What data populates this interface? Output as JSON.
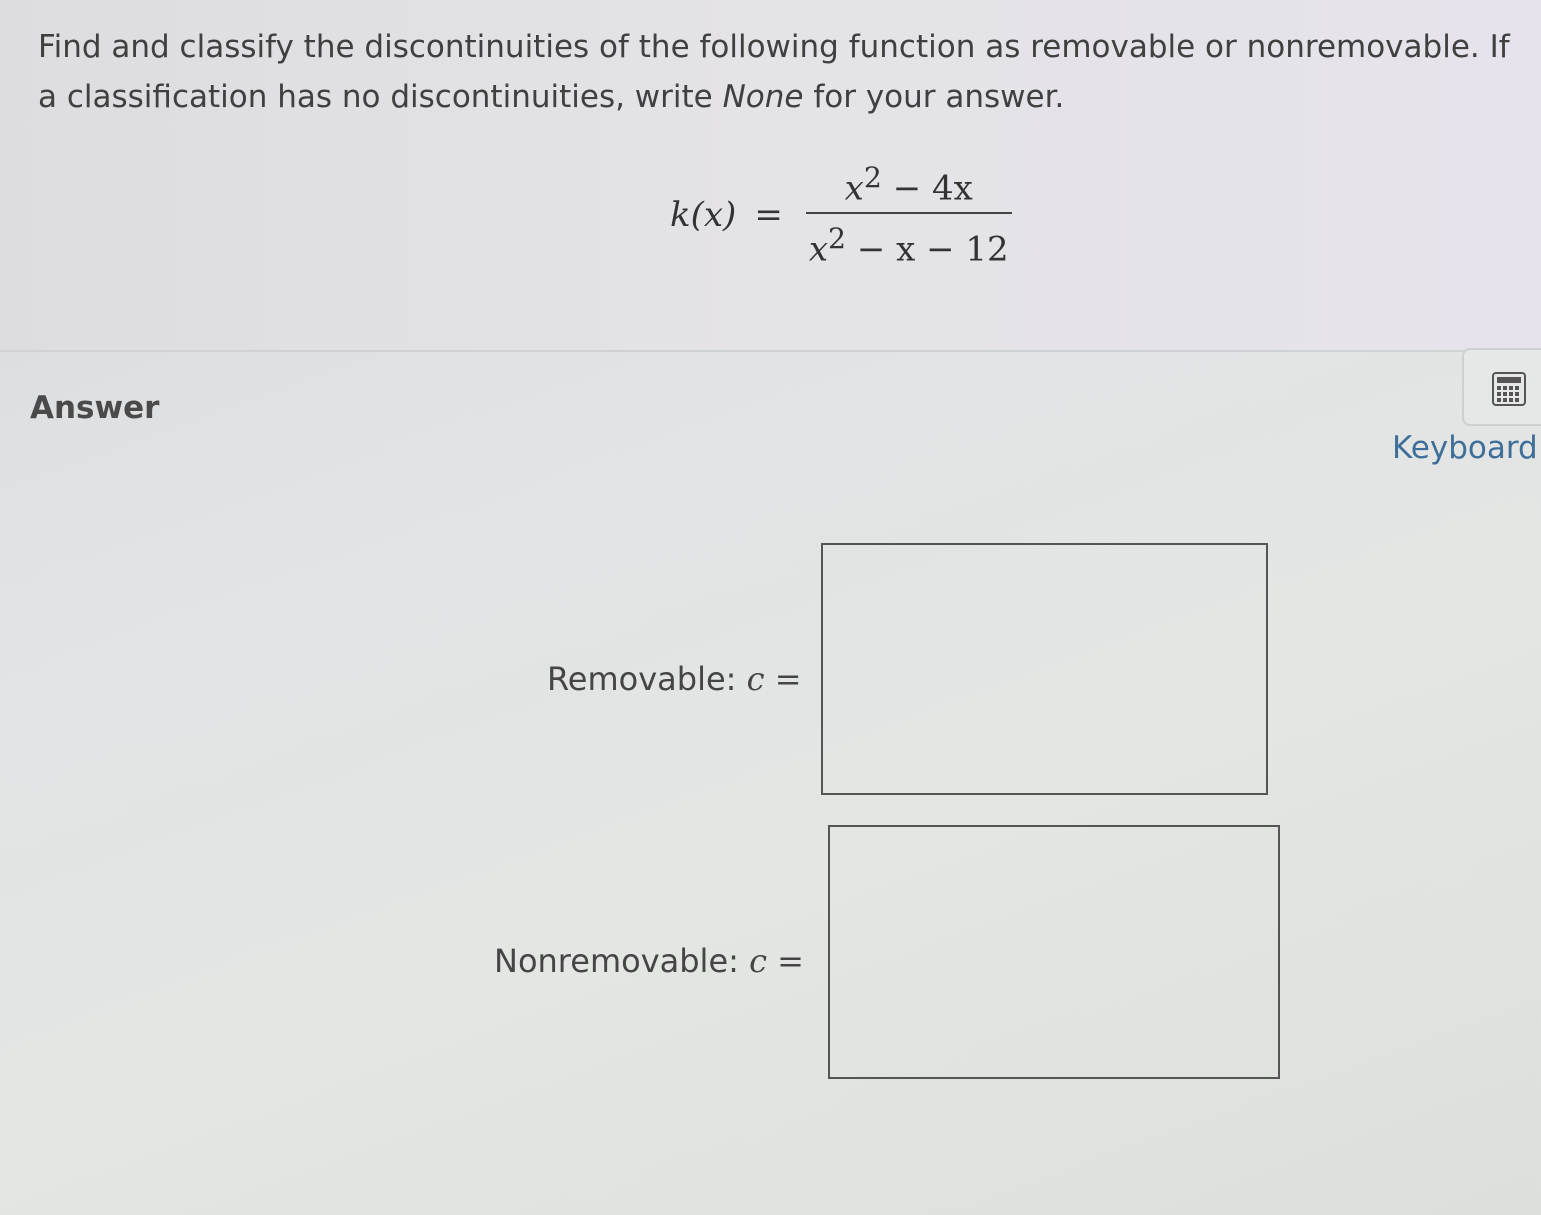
{
  "question": {
    "prompt_part1": "Find and classify the discontinuities of the following function as removable or nonremovable. If a classification has no discontinuities, write ",
    "prompt_emphasis": "None",
    "prompt_part2": " for your answer.",
    "function_lhs": "k(x)",
    "function_equals": "=",
    "numerator_x": "x",
    "numerator_exp": "2",
    "numerator_rest": " − 4x",
    "denominator_x": "x",
    "denominator_exp": "2",
    "denominator_rest": " − x − 12"
  },
  "answer": {
    "heading": "Answer",
    "keyboard_label": "Keyboard",
    "keyboard_icon": "calculator-keypad-icon",
    "removable": {
      "label": "Removable: ",
      "variable": "c",
      "equals": " =",
      "value": ""
    },
    "nonremovable": {
      "label": "Nonremovable: ",
      "variable": "c",
      "equals": " =",
      "value": ""
    }
  }
}
